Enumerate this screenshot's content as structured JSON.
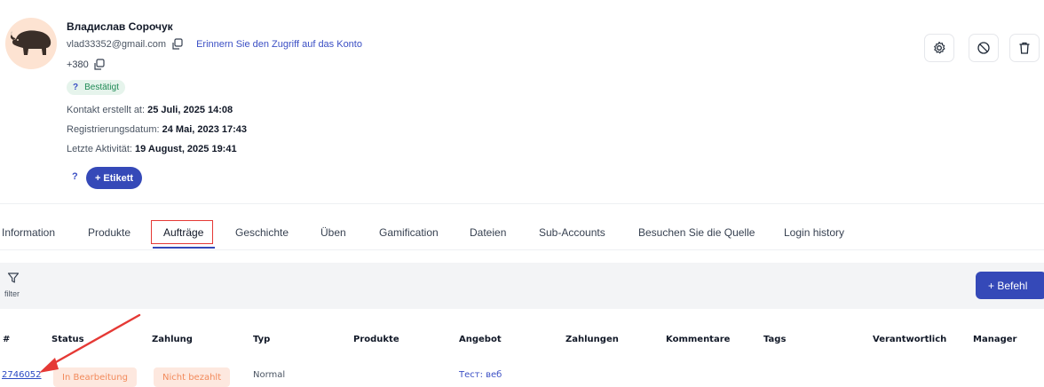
{
  "profile": {
    "name": "Владислав Сорочук",
    "email": "vlad33352@gmail.com",
    "remind_link": "Erinnern Sie den Zugriff auf das Konto",
    "phone": "+380",
    "verified_q": "?",
    "verified_label": "Bestätigt",
    "created_label": "Kontakt erstellt at:",
    "created_value": "25 Juli, 2025 14:08",
    "registered_label": "Registrierungsdatum:",
    "registered_value": "24 Mai, 2023 17:43",
    "activity_label": "Letzte Aktivität:",
    "activity_value": "19 August, 2025 19:41",
    "tag_help": "?",
    "tag_button": "+ Etikett"
  },
  "actions": {
    "settings_icon": "gear-icon",
    "block_icon": "ban-icon",
    "delete_icon": "trash-icon"
  },
  "tabs": [
    {
      "label": "Information"
    },
    {
      "label": "Produkte"
    },
    {
      "label": "Aufträge",
      "active": true
    },
    {
      "label": "Geschichte"
    },
    {
      "label": "Üben"
    },
    {
      "label": "Gamification"
    },
    {
      "label": "Dateien"
    },
    {
      "label": "Sub-Accounts"
    },
    {
      "label": "Besuchen Sie die Quelle"
    },
    {
      "label": "Login history"
    }
  ],
  "filter": {
    "label": "filter",
    "add_button": "+ Befehl"
  },
  "table": {
    "headers": [
      "#",
      "Status",
      "Zahlung",
      "Typ",
      "Produkte",
      "Angebot",
      "Zahlungen",
      "Kommentare",
      "Tags",
      "Verantwortlich",
      "Manager"
    ],
    "rows": [
      {
        "id": "2746052",
        "status": "In Bearbeitung",
        "payment": "Nicht bezahlt",
        "type": "Normal",
        "products": "",
        "offer": "Тест: веб",
        "payments": "",
        "comments": "",
        "tags": "",
        "responsible": "",
        "manager": ""
      }
    ]
  },
  "colors": {
    "accent": "#3549b8",
    "link": "#2b4ac4",
    "highlight": "#e53935",
    "status_bg": "#fde8df",
    "status_fg": "#f28a5b",
    "verified_bg": "#e6f4ec",
    "verified_fg": "#1f8a55"
  }
}
